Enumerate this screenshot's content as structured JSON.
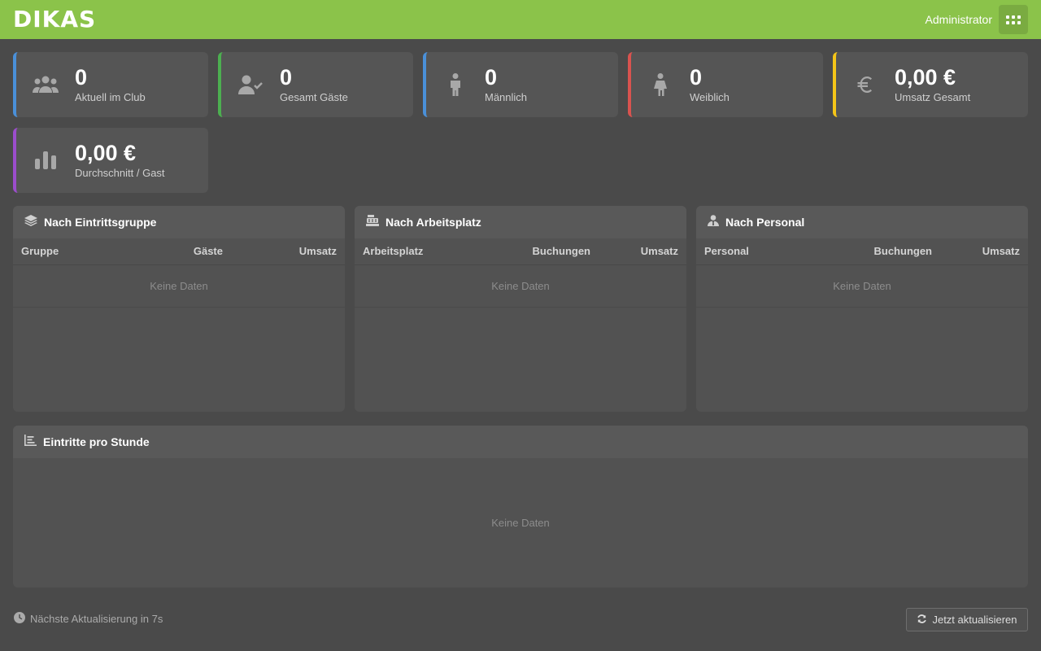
{
  "header": {
    "logo_text": "DIKAS",
    "user_name": "Administrator",
    "apps_icon": "apps-grid-icon",
    "accent_color": "#8bc34a"
  },
  "stats": [
    {
      "value": "0",
      "label": "Aktuell im Club",
      "icon": "group-icon",
      "color": "#4a90d9"
    },
    {
      "value": "0",
      "label": "Gesamt Gäste",
      "icon": "user-check-icon",
      "color": "#4caf50"
    },
    {
      "value": "0",
      "label": "Männlich",
      "icon": "male-icon",
      "color": "#4a90d9"
    },
    {
      "value": "0",
      "label": "Weiblich",
      "icon": "female-icon",
      "color": "#d9534f"
    },
    {
      "value": "0,00 €",
      "label": "Umsatz Gesamt",
      "icon": "euro-icon",
      "color": "#f5c518"
    },
    {
      "value": "0,00 €",
      "label": "Durchschnitt / Gast",
      "icon": "bar-chart-icon",
      "color": "#9c4dcc"
    }
  ],
  "panels": {
    "eintrittsgruppe": {
      "title": "Nach Eintrittsgruppe",
      "icon": "layers-icon",
      "columns": [
        "Gruppe",
        "Gäste",
        "Umsatz"
      ],
      "empty_text": "Keine Daten"
    },
    "arbeitsplatz": {
      "title": "Nach Arbeitsplatz",
      "icon": "cash-register-icon",
      "columns": [
        "Arbeitsplatz",
        "Buchungen",
        "Umsatz"
      ],
      "empty_text": "Keine Daten"
    },
    "personal": {
      "title": "Nach Personal",
      "icon": "user-tie-icon",
      "columns": [
        "Personal",
        "Buchungen",
        "Umsatz"
      ],
      "empty_text": "Keine Daten"
    },
    "stunde": {
      "title": "Eintritte pro Stunde",
      "icon": "area-chart-icon",
      "empty_text": "Keine Daten"
    }
  },
  "footer": {
    "status_text": "Nächste Aktualisierung in 7s",
    "status_icon": "clock-icon",
    "refresh_label": "Jetzt aktualisieren",
    "refresh_icon": "refresh-icon"
  }
}
